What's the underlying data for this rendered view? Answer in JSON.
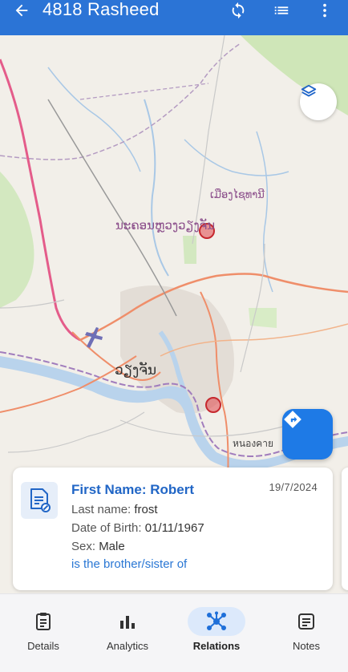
{
  "app_bar": {
    "title": "4818 Rasheed",
    "icons": [
      "back-arrow-icon",
      "sync-icon",
      "list-icon",
      "more-vertical-icon"
    ]
  },
  "map": {
    "labels": {
      "province": "ເມືອງໄຊທານີ",
      "city_district": "ນະຄອນຫຼວງວຽງຈັນ",
      "city": "ວຽງຈັນ",
      "nong_khai": "หนองคาย"
    },
    "markers_count": 2
  },
  "card": {
    "first_name": "First Name: Robert",
    "date": "19/7/2024",
    "last_name_label": "Last name:",
    "last_name": "frost",
    "dob_label": "Date of Birth:",
    "dob": "01/11/1967",
    "sex_label": "Sex:",
    "sex": "Male",
    "relation": "is the brother/sister of"
  },
  "bottom_nav": {
    "items": [
      {
        "label": "Details",
        "icon": "details-icon",
        "active": false
      },
      {
        "label": "Analytics",
        "icon": "bar-chart-icon",
        "active": false
      },
      {
        "label": "Relations",
        "icon": "relations-icon",
        "active": true
      },
      {
        "label": "Notes",
        "icon": "notes-icon",
        "active": false
      }
    ]
  },
  "colors": {
    "primary": "#2b74d6",
    "fab": "#1e7ae6",
    "marker": "#e0454a",
    "active_nav_bg": "#dce9fb"
  }
}
